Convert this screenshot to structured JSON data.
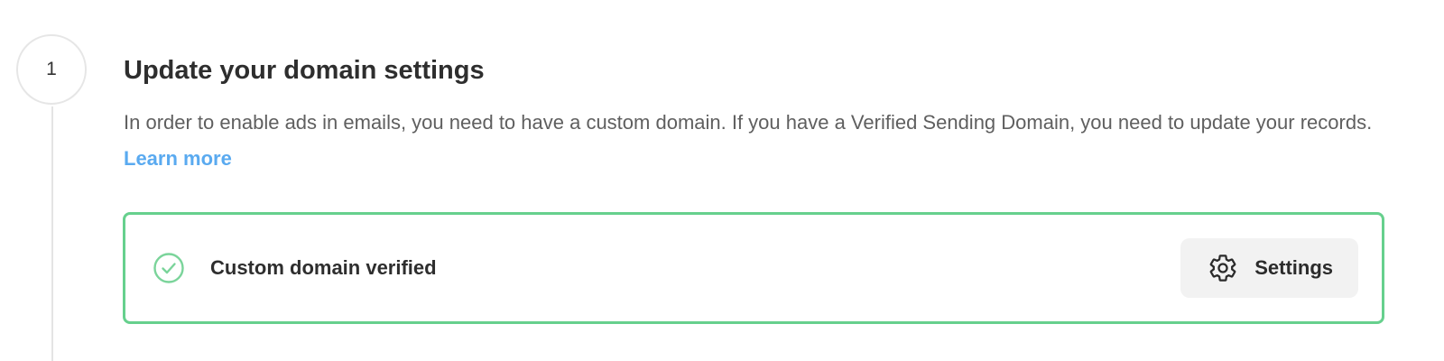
{
  "step": {
    "number": "1",
    "title": "Update your domain settings",
    "description": "In order to enable ads in emails, you need to have a custom domain. If you have a Verified Sending Domain, you need to update your records.",
    "learn_more_label": "Learn more"
  },
  "status_card": {
    "status_text": "Custom domain verified",
    "status_icon": "check-circle-icon",
    "border_color": "#66d08d",
    "settings_button": {
      "label": "Settings",
      "icon": "gear-icon"
    }
  },
  "colors": {
    "link": "#5aaaf0",
    "success": "#66d08d"
  }
}
